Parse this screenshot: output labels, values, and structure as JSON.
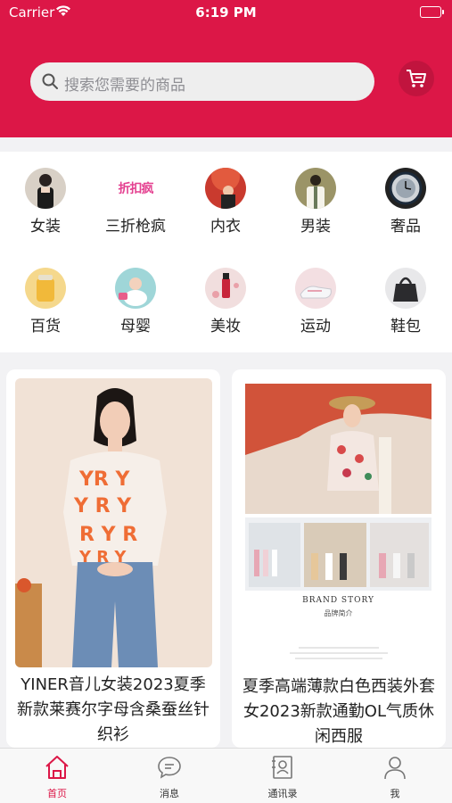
{
  "status_bar": {
    "carrier": "Carrier",
    "time": "6:19 PM"
  },
  "search": {
    "placeholder": "搜索您需要的商品"
  },
  "categories": [
    {
      "label": "女装",
      "icon": "womens-clothing-icon"
    },
    {
      "label": "三折枪疯",
      "icon": "flash-sale-logo",
      "logo_text": "折扣疯"
    },
    {
      "label": "内衣",
      "icon": "underwear-icon"
    },
    {
      "label": "男装",
      "icon": "mens-clothing-icon"
    },
    {
      "label": "奢品",
      "icon": "luxury-watch-icon"
    },
    {
      "label": "百货",
      "icon": "general-goods-icon"
    },
    {
      "label": "母婴",
      "icon": "mother-baby-icon"
    },
    {
      "label": "美妆",
      "icon": "cosmetics-icon"
    },
    {
      "label": "运动",
      "icon": "sports-icon"
    },
    {
      "label": "鞋包",
      "icon": "shoes-bags-icon"
    }
  ],
  "products": [
    {
      "title": "YINER音儿女装2023夏季新款莱赛尔字母含桑蚕丝针织衫"
    },
    {
      "title": "夏季高端薄款白色西装外套女2023新款通勤OL气质休闲西服",
      "brand_story": "BRAND STORY",
      "brand_story_sub": "品牌简介"
    }
  ],
  "tabbar": [
    {
      "label": "首页",
      "icon": "home-icon",
      "active": true
    },
    {
      "label": "消息",
      "icon": "message-icon",
      "active": false
    },
    {
      "label": "通讯录",
      "icon": "contacts-icon",
      "active": false
    },
    {
      "label": "我",
      "icon": "profile-icon",
      "active": false
    }
  ],
  "colors": {
    "brand": "#dc1747",
    "active_tab": "#dc1747"
  }
}
